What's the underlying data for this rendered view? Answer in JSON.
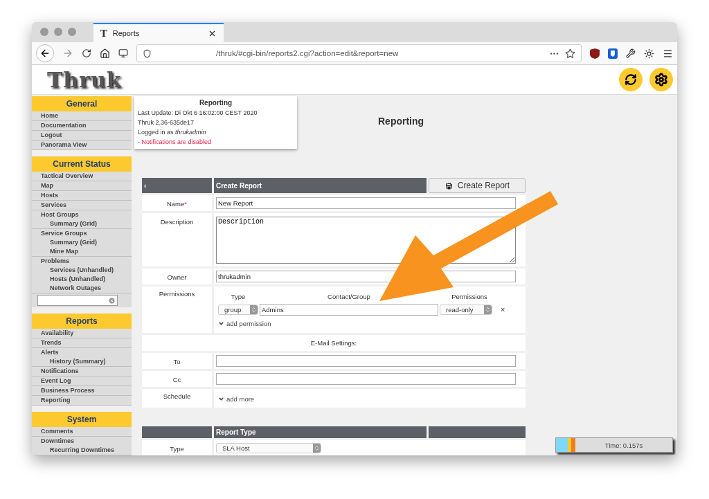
{
  "browser": {
    "tab": {
      "icon": "T",
      "title": "Reports",
      "selected": true
    },
    "url": "/thruk/#cgi-bin/reports2.cgi?action=edit&report=new"
  },
  "header": {
    "logo": "Thruk"
  },
  "sidebar": [
    {
      "title": "General",
      "items": [
        {
          "label": "Home"
        },
        {
          "label": "Documentation"
        },
        {
          "label": "Logout"
        },
        {
          "label": "Panorama View"
        }
      ]
    },
    {
      "title": "Current Status",
      "items": [
        {
          "label": "Tactical Overview"
        },
        {
          "label": "Map"
        },
        {
          "label": "Hosts"
        },
        {
          "label": "Services"
        },
        {
          "label": "Host Groups",
          "children": [
            {
              "label": "Summary (Grid)"
            }
          ]
        },
        {
          "label": "Service Groups",
          "children": [
            {
              "label": "Summary (Grid)"
            },
            {
              "label": "Mine Map"
            }
          ]
        },
        {
          "label": "Problems",
          "children": [
            {
              "label": "Services (Unhandled)"
            },
            {
              "label": "Hosts (Unhandled)"
            },
            {
              "label": "Network Outages"
            }
          ]
        }
      ],
      "search": true
    },
    {
      "title": "Reports",
      "items": [
        {
          "label": "Availability"
        },
        {
          "label": "Trends"
        },
        {
          "label": "Alerts",
          "children": [
            {
              "label": "History (Summary)"
            }
          ]
        },
        {
          "label": "Notifications"
        },
        {
          "label": "Event Log"
        },
        {
          "label": "Business Process"
        },
        {
          "label": "Reporting"
        }
      ]
    },
    {
      "title": "System",
      "items": [
        {
          "label": "Comments"
        },
        {
          "label": "Downtimes",
          "children": [
            {
              "label": "Recurring Downtimes"
            }
          ]
        }
      ]
    }
  ],
  "info": {
    "title": "Reporting",
    "lines": [
      "Last Update: Di Okt 6 16:02:00 CEST 2020",
      "Thruk 2.36-635de17",
      "Logged in as *thrukadmin*"
    ],
    "warning": "- Notifications are disabled"
  },
  "page_title": "Reporting",
  "form": {
    "back": "‹",
    "title": "Create Report",
    "submit": "Create Report",
    "rows": [
      {
        "kind": "input",
        "label": "Name",
        "required_mark": "*",
        "value": "New Report"
      },
      {
        "kind": "textarea",
        "label": "Description",
        "value": "Description"
      },
      {
        "kind": "input",
        "label": "Owner",
        "value": "thrukadmin"
      },
      {
        "kind": "permissions",
        "label": "Permissions",
        "columns": [
          "Type",
          "Contact/Group",
          "Permissions"
        ],
        "entries": [
          {
            "type": "group",
            "contact": "Admins",
            "permission": "read-only",
            "remove": "×"
          }
        ],
        "add": "add permission"
      },
      {
        "kind": "section",
        "label": "E-Mail Settings:"
      },
      {
        "kind": "input",
        "label": "To",
        "value": ""
      },
      {
        "kind": "input",
        "label": "Cc",
        "value": ""
      },
      {
        "kind": "link",
        "label": "Schedule",
        "value": "add more"
      }
    ]
  },
  "report_type": {
    "title": "Report Type",
    "rows": [
      {
        "label": "Type",
        "value": "SLA Host"
      }
    ]
  },
  "timer": "Time: 0.157s"
}
